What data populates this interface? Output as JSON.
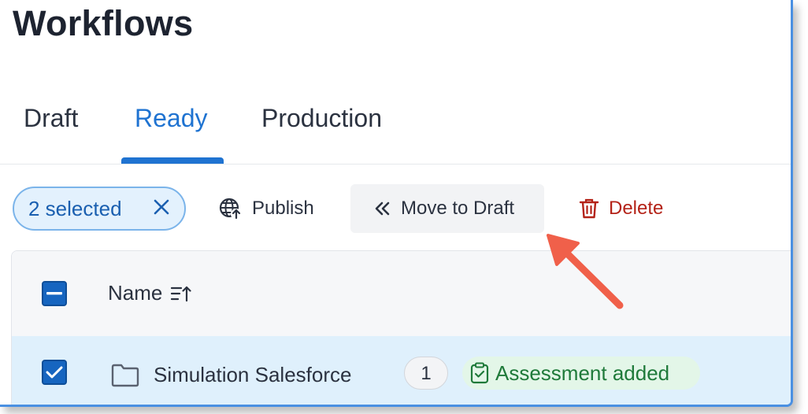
{
  "page": {
    "title": "Workflows"
  },
  "tabs": [
    {
      "label": "Draft",
      "active": false
    },
    {
      "label": "Ready",
      "active": true
    },
    {
      "label": "Production",
      "active": false
    }
  ],
  "toolbar": {
    "selection_label": "2 selected",
    "clear_icon": "close-icon",
    "publish_label": "Publish",
    "publish_icon": "globe-upload-icon",
    "move_label": "Move to Draft",
    "move_icon": "double-chevron-left-icon",
    "delete_label": "Delete",
    "delete_icon": "trash-icon"
  },
  "table": {
    "header": {
      "name_label": "Name",
      "sort_icon": "sort-ascending-icon"
    },
    "rows": [
      {
        "name": "Simulation Salesforce",
        "icon": "folder-icon",
        "count": "1",
        "badge": "Assessment added",
        "badge_icon": "clipboard-check-icon",
        "selected": true
      }
    ]
  },
  "colors": {
    "accent": "#1f73d1",
    "danger": "#b42318",
    "success": "#1f7a3a",
    "annotation_arrow": "#f0604a"
  }
}
